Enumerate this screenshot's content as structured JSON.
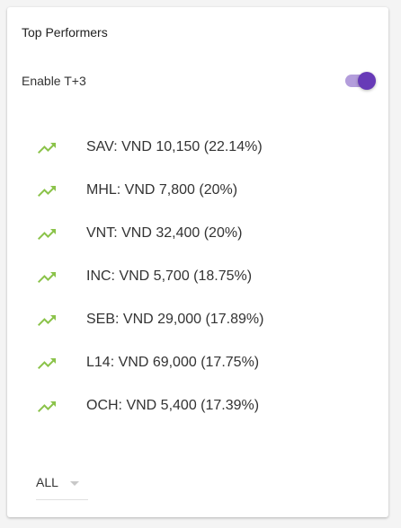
{
  "card": {
    "title": "Top Performers"
  },
  "toggle": {
    "label": "Enable T+3",
    "on": true
  },
  "performers": [
    {
      "text": "SAV: VND 10,150 (22.14%)",
      "icon": "trending-up-icon"
    },
    {
      "text": "MHL: VND 7,800 (20%)",
      "icon": "trending-up-icon"
    },
    {
      "text": "VNT: VND 32,400 (20%)",
      "icon": "trending-up-icon"
    },
    {
      "text": "INC: VND 5,700 (18.75%)",
      "icon": "trending-up-icon"
    },
    {
      "text": "SEB: VND 29,000 (17.89%)",
      "icon": "trending-up-icon"
    },
    {
      "text": "L14: VND 69,000 (17.75%)",
      "icon": "trending-up-icon"
    },
    {
      "text": "OCH: VND 5,400 (17.39%)",
      "icon": "trending-up-icon"
    }
  ],
  "filter": {
    "selected": "ALL"
  },
  "colors": {
    "trend_up": "#8bc34a",
    "accent": "#673ab7",
    "accent_light": "#b39ddb"
  }
}
